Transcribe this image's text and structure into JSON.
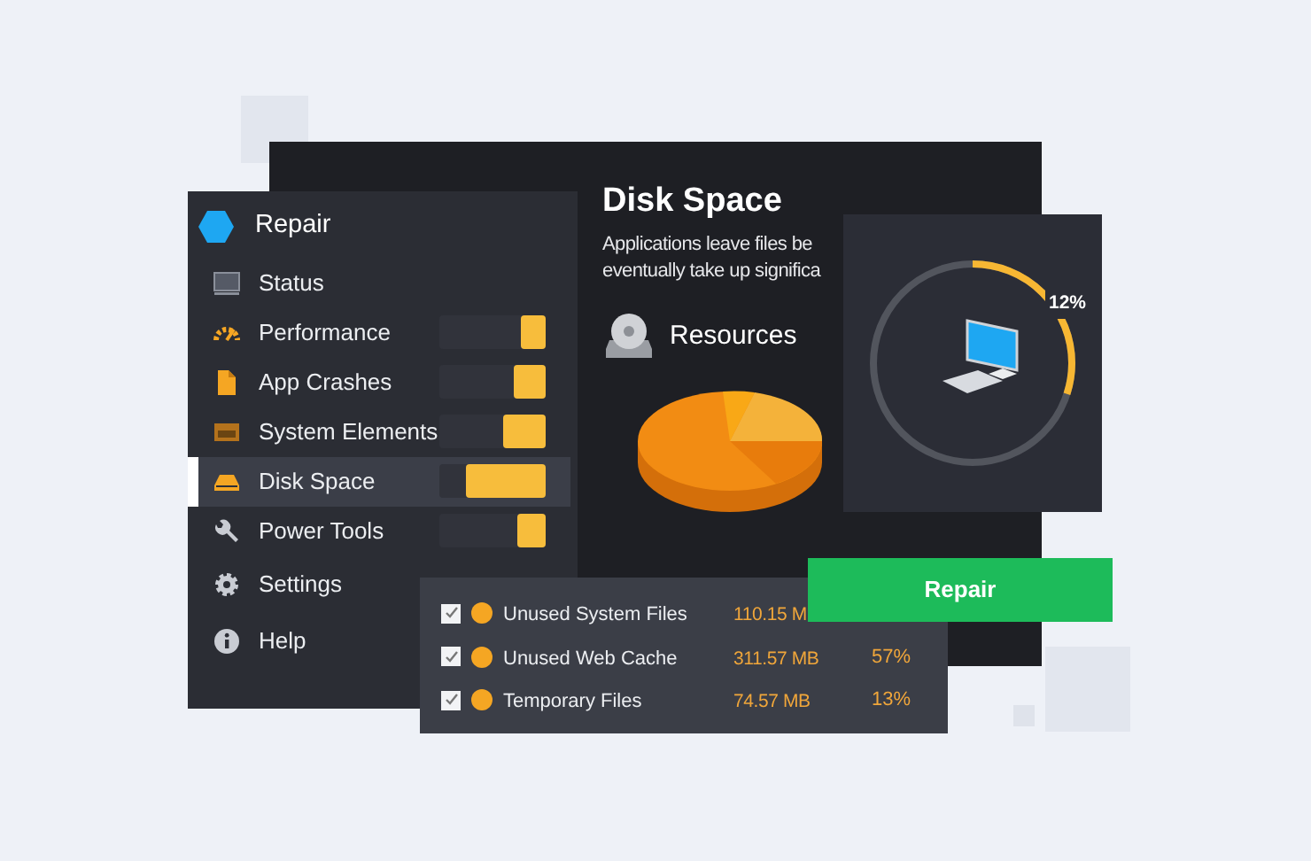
{
  "sidebar": {
    "title": "Repair",
    "items": [
      {
        "label": "Status",
        "selected": false
      },
      {
        "label": "Performance",
        "selected": false,
        "level": 0.23
      },
      {
        "label": "App  Crashes",
        "selected": false,
        "level": 0.3
      },
      {
        "label": "System Elements",
        "selected": false,
        "level": 0.4
      },
      {
        "label": "Disk Space",
        "selected": true,
        "level": 0.75
      },
      {
        "label": "Power Tools",
        "selected": false,
        "level": 0.27
      },
      {
        "label": "Settings",
        "selected": false
      },
      {
        "label": "Help",
        "selected": false
      }
    ]
  },
  "main": {
    "title": "Disk Space",
    "description": [
      "Applications leave files be",
      "eventually take up significa"
    ],
    "section": "Resources"
  },
  "status_card": {
    "reading": "12%",
    "level": 0.3
  },
  "repair_button": "Repair",
  "files": [
    {
      "label": "Unused System Files",
      "size": "110.15 M",
      "checked": true
    },
    {
      "label": "Unused Web Cache",
      "size": "311.57 MB",
      "percent": "57%",
      "checked": true
    },
    {
      "label": "Temporary Files",
      "size": "74.57 MB",
      "percent": "13%",
      "checked": true
    }
  ]
}
